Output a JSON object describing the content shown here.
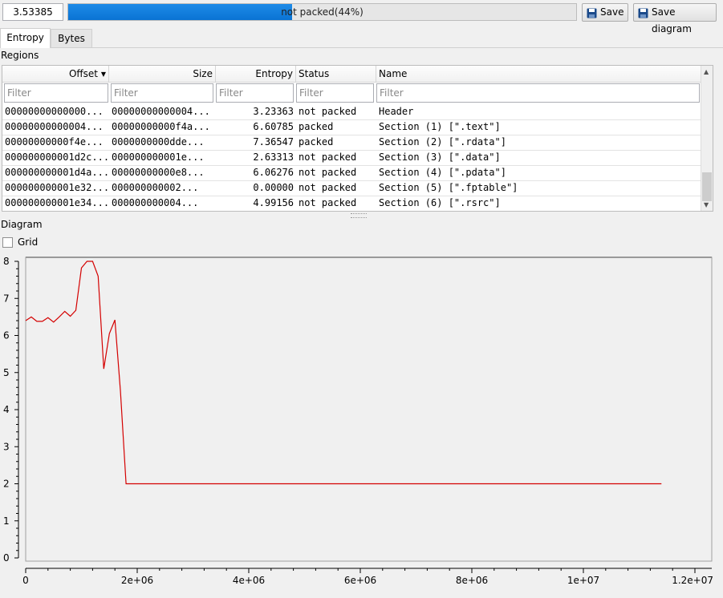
{
  "toolbar": {
    "entropy_value": "3.53385",
    "progress_text": "not packed(44%)",
    "progress_percent": 44,
    "save_label": "Save",
    "save_diagram_label": "Save diagram"
  },
  "tabs": [
    {
      "label": "Entropy",
      "active": true
    },
    {
      "label": "Bytes",
      "active": false
    }
  ],
  "regions_label": "Regions",
  "table": {
    "columns": [
      "Offset",
      "Size",
      "Entropy",
      "Status",
      "Name"
    ],
    "filter_placeholder": "Filter",
    "rows": [
      [
        "00000000000000...",
        "00000000000004...",
        "3.23363",
        "not packed",
        "Header"
      ],
      [
        "00000000000004...",
        "00000000000f4a...",
        "6.60785",
        "packed",
        "Section (1) [\".text\"]"
      ],
      [
        "00000000000f4e...",
        "0000000000dde...",
        "7.36547",
        "packed",
        "Section (2) [\".rdata\"]"
      ],
      [
        "000000000001d2c...",
        "000000000001e...",
        "2.63313",
        "not packed",
        "Section (3) [\".data\"]"
      ],
      [
        "000000000001d4a...",
        "00000000000e8...",
        "6.06276",
        "not packed",
        "Section (4) [\".pdata\"]"
      ],
      [
        "000000000001e32...",
        "000000000002...",
        "0.00000",
        "not packed",
        "Section (5) [\".fptable\"]"
      ],
      [
        "000000000001e34...",
        "000000000004...",
        "4.99156",
        "not packed",
        "Section (6) [\".rsrc\"]"
      ]
    ]
  },
  "diagram_label": "Diagram",
  "grid_label": "Grid",
  "colors": {
    "line": "#d40000",
    "progress": "#1482e0"
  },
  "chart_data": {
    "type": "line",
    "x": [
      0,
      100000,
      200000,
      300000,
      400000,
      500000,
      600000,
      700000,
      800000,
      900000,
      1000000,
      1100000,
      1200000,
      1300000,
      1400000,
      1500000,
      1600000,
      1700000,
      1800000,
      1900000,
      2000000,
      2050000,
      3000000,
      5000000,
      7000000,
      9000000,
      11000000,
      11400000
    ],
    "y": [
      6.4,
      6.5,
      6.38,
      6.38,
      6.48,
      6.36,
      6.5,
      6.65,
      6.52,
      6.68,
      7.82,
      8.0,
      8.0,
      7.6,
      5.1,
      6.05,
      6.42,
      4.5,
      2.0,
      2.0,
      2.0,
      2.0,
      2.0,
      2.0,
      2.0,
      2.0,
      2.0,
      2.0
    ],
    "xlim": [
      0,
      12000000
    ],
    "ylim": [
      0,
      8
    ],
    "x_ticks": [
      "0",
      "2e+06",
      "4e+06",
      "6e+06",
      "8e+06",
      "1e+07",
      "1.2e+07"
    ],
    "y_ticks": [
      "0",
      "1",
      "2",
      "3",
      "4",
      "5",
      "6",
      "7",
      "8"
    ],
    "grid": false
  }
}
